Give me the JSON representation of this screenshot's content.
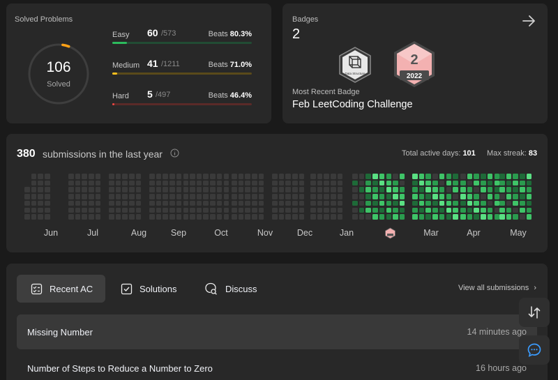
{
  "solved": {
    "title": "Solved Problems",
    "total": "106",
    "total_label": "Solved",
    "progress_fraction": 0.035,
    "easy": {
      "name": "Easy",
      "solved": "60",
      "total": "/573",
      "beats_label": "Beats",
      "beats_value": "80.3%",
      "fraction": 0.105,
      "color": "#2cbb5d"
    },
    "medium": {
      "name": "Medium",
      "solved": "41",
      "total": "/1211",
      "beats_label": "Beats",
      "beats_value": "71.0%",
      "fraction": 0.034,
      "color": "#ffc01e"
    },
    "hard": {
      "name": "Hard",
      "solved": "5",
      "total": "/497",
      "beats_label": "Beats",
      "beats_value": "46.4%",
      "fraction": 0.01,
      "color": "#ef4743"
    }
  },
  "badges": {
    "title": "Badges",
    "count": "2",
    "recent_label": "Most Recent Badge",
    "recent_name": "Feb LeetCoding Challenge",
    "ds_badge_text": "Data Structure",
    "year_badge_number": "2",
    "year_badge_year": "2022"
  },
  "calendar": {
    "count": "380",
    "label": "submissions in the last year",
    "active_label": "Total active days:",
    "active_value": "101",
    "streak_label": "Max streak:",
    "streak_value": "83",
    "months": [
      "Jun",
      "Jul",
      "Aug",
      "Sep",
      "Oct",
      "Nov",
      "Dec",
      "Jan",
      "Mar",
      "Apr",
      "May"
    ],
    "colors": {
      "empty": "#3a3a3a",
      "l1": "#1e6a38",
      "l2": "#2a9b4e",
      "l3": "#3fc468",
      "l4": "#5ae083"
    }
  },
  "recent": {
    "tabs": [
      {
        "label": "Recent AC",
        "icon": "checklist-icon"
      },
      {
        "label": "Solutions",
        "icon": "solution-check-icon"
      },
      {
        "label": "Discuss",
        "icon": "discuss-icon"
      }
    ],
    "view_all": "View all submissions",
    "rows": [
      {
        "title": "Missing Number",
        "time": "14 minutes ago"
      },
      {
        "title": "Number of Steps to Reduce a Number to Zero",
        "time": "16 hours ago"
      }
    ]
  }
}
